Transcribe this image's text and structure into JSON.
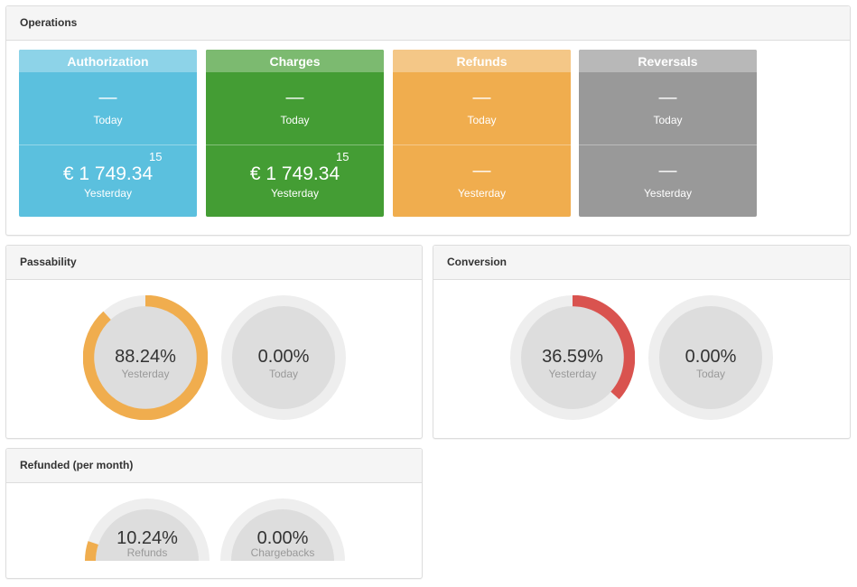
{
  "colors": {
    "authorization": "#5bc0de",
    "authorization_head": "#8dd3e8",
    "charges": "#449d34",
    "charges_head": "#7cba70",
    "refunds": "#f0ad4e",
    "refunds_head": "#f4c787",
    "reversals": "#999999",
    "reversals_head": "#b8b8b8",
    "gauge_track": "#eeeeee",
    "gauge_inner": "#dddddd",
    "passability": "#f0ad4e",
    "conversion": "#d9534f",
    "refunded": "#f0ad4e"
  },
  "operations": {
    "title": "Operations",
    "tiles": [
      {
        "name": "Authorization",
        "color_key": "authorization",
        "today": {
          "value": "—",
          "label": "Today"
        },
        "yesterday": {
          "value": "€ 1 749.34",
          "count": "15",
          "label": "Yesterday"
        }
      },
      {
        "name": "Charges",
        "color_key": "charges",
        "today": {
          "value": "—",
          "label": "Today"
        },
        "yesterday": {
          "value": "€ 1 749.34",
          "count": "15",
          "label": "Yesterday"
        }
      },
      {
        "name": "Refunds",
        "color_key": "refunds",
        "today": {
          "value": "—",
          "label": "Today"
        },
        "yesterday": {
          "value": "—",
          "count": "",
          "label": "Yesterday"
        }
      },
      {
        "name": "Reversals",
        "color_key": "reversals",
        "today": {
          "value": "—",
          "label": "Today"
        },
        "yesterday": {
          "value": "—",
          "count": "",
          "label": "Yesterday"
        }
      }
    ]
  },
  "passability": {
    "title": "Passability",
    "gauges": [
      {
        "value_text": "88.24%",
        "fraction": 0.8824,
        "label": "Yesterday"
      },
      {
        "value_text": "0.00%",
        "fraction": 0,
        "label": "Today"
      }
    ]
  },
  "conversion": {
    "title": "Conversion",
    "gauges": [
      {
        "value_text": "36.59%",
        "fraction": 0.3659,
        "label": "Yesterday"
      },
      {
        "value_text": "0.00%",
        "fraction": 0,
        "label": "Today"
      }
    ]
  },
  "refunded": {
    "title": "Refunded (per month)",
    "gauges": [
      {
        "value_text": "10.24%",
        "fraction": 0.1024,
        "label": "Refunds"
      },
      {
        "value_text": "0.00%",
        "fraction": 0,
        "label": "Chargebacks"
      }
    ]
  }
}
